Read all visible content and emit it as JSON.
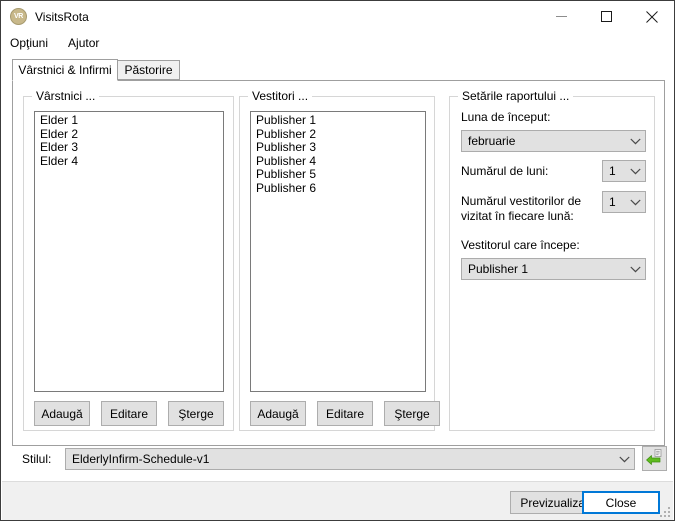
{
  "window": {
    "title": "VisitsRota",
    "icon_label": "VR",
    "icon_name": "app-icon",
    "controls": {
      "minimize": "minimize-icon",
      "maximize": "maximize-icon",
      "close": "close-icon"
    }
  },
  "menubar": {
    "items": [
      {
        "label": "Opţiuni"
      },
      {
        "label": "Ajutor"
      }
    ]
  },
  "tabs": [
    {
      "label": "Vârstnici & Infirmi",
      "active": true
    },
    {
      "label": "Păstorire",
      "active": false
    }
  ],
  "elders_group": {
    "legend": "Vârstnici ...",
    "items": [
      "Elder 1",
      "Elder 2",
      "Elder 3",
      "Elder 4"
    ],
    "buttons": {
      "add": "Adaugă",
      "edit": "Editare",
      "delete": "Şterge"
    }
  },
  "publishers_group": {
    "legend": "Vestitori ...",
    "items": [
      "Publisher 1",
      "Publisher 2",
      "Publisher 3",
      "Publisher 4",
      "Publisher 5",
      "Publisher 6"
    ],
    "buttons": {
      "add": "Adaugă",
      "edit": "Editare",
      "delete": "Şterge"
    }
  },
  "report_settings": {
    "legend": "Setările raportului ...",
    "start_month": {
      "label": "Luna de început:",
      "value": "februarie"
    },
    "number_of_months": {
      "label": "Numărul de luni:",
      "value": "1"
    },
    "publishers_per_month": {
      "label_line1": "Numărul vestitorilor de",
      "label_line2": "vizitat în fiecare lună:",
      "value": "1"
    },
    "starting_publisher": {
      "label": "Vestitorul care începe:",
      "value": "Publisher 1"
    }
  },
  "style_row": {
    "label": "Stilul:",
    "value": "ElderlyInfirm-Schedule-v1",
    "import_icon": "import-style-icon"
  },
  "footer": {
    "preview_label": "Previzualizare",
    "close_label": "Close",
    "resize_grip": "resize-grip"
  },
  "colors": {
    "accent": "#0078d7",
    "control_face": "#e1e1e1",
    "dialog_bg": "#ffffff",
    "footer_bg": "#f0f0f0",
    "group_border": "#d6d6d6",
    "icon_green": "#5fbb1f"
  }
}
